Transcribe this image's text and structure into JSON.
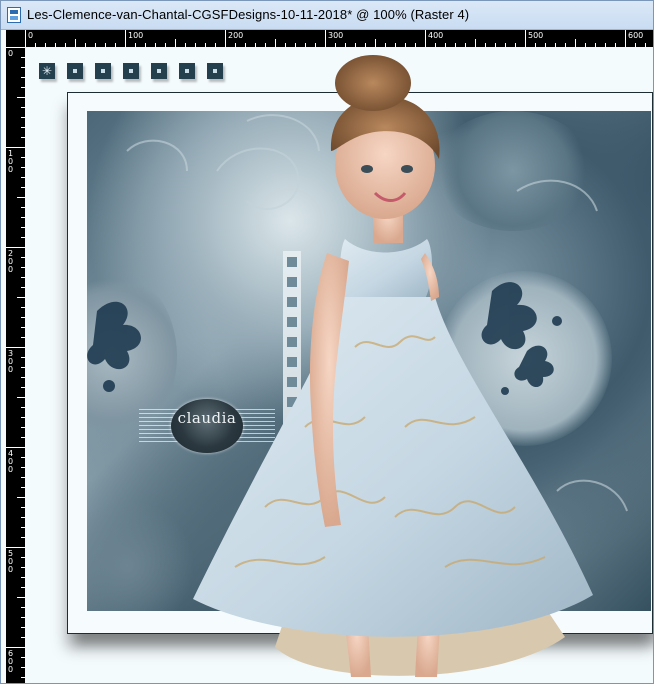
{
  "window": {
    "title": "Les-Clemence-van-Chantal-CGSFDesigns-10-11-2018* @ 100% (Raster 4)",
    "icon": "psp-document-icon"
  },
  "rulers": {
    "horizontal_labels": [
      "0",
      "100",
      "200",
      "300",
      "400",
      "500",
      "600"
    ],
    "vertical_labels": [
      "0",
      "100",
      "200",
      "300",
      "400",
      "500",
      "600"
    ]
  },
  "canvas": {
    "toolbar_buttons": [
      "sparkle-icon",
      "square-icon",
      "square-icon",
      "square-icon",
      "square-icon",
      "square-icon",
      "square-icon"
    ],
    "watermark_text": "claudia",
    "colors": {
      "frame_border": "#1e2c34",
      "background_blue": "#4b6778",
      "button": "#24404f",
      "dress": "#cfe0ea"
    }
  }
}
